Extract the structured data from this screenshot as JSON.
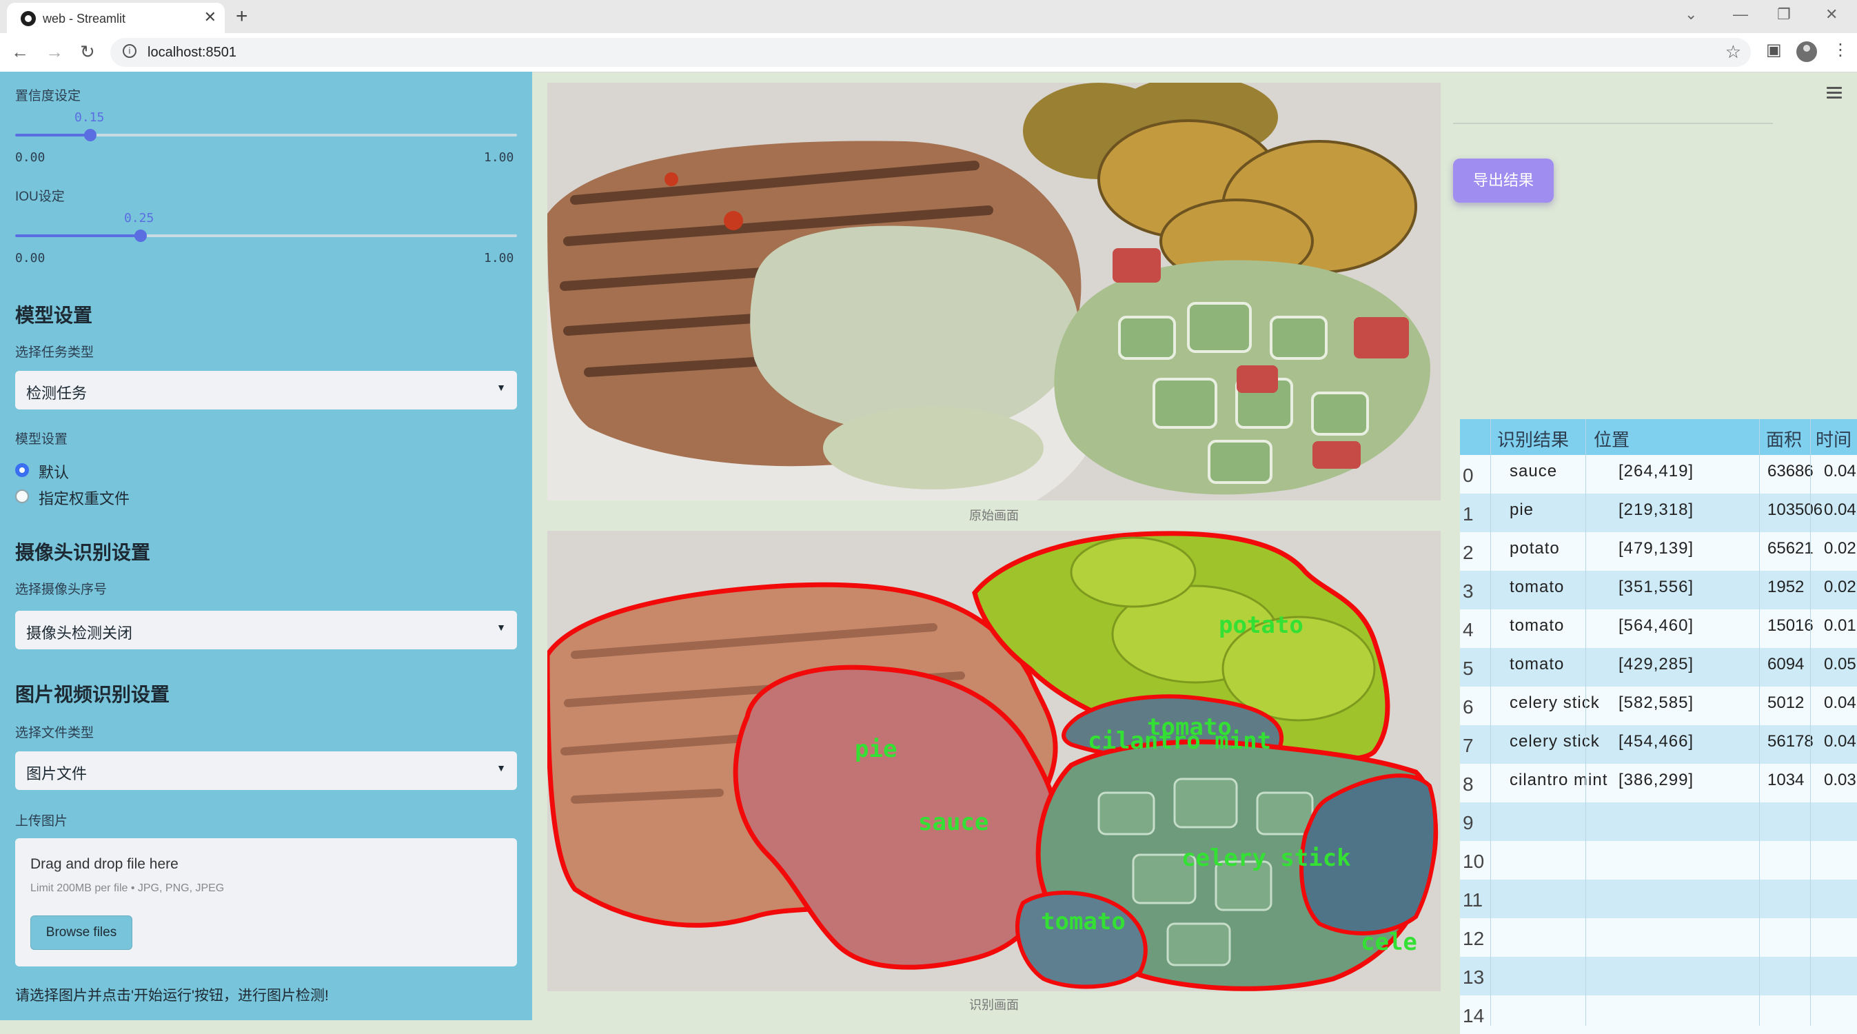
{
  "browser": {
    "tab_title": "web - Streamlit",
    "new_tab": "+",
    "url": "localhost:8501"
  },
  "sidebar": {
    "confidence": {
      "label": "置信度设定",
      "value": "0.15",
      "min": "0.00",
      "max": "1.00",
      "fraction": 0.15
    },
    "iou": {
      "label": "IOU设定",
      "value": "0.25",
      "min": "0.00",
      "max": "1.00",
      "fraction": 0.25
    },
    "model_section": "模型设置",
    "task_label": "选择任务类型",
    "task_value": "检测任务",
    "model_label": "模型设置",
    "radio_default": "默认",
    "radio_custom": "指定权重文件",
    "camera_section": "摄像头识别设置",
    "camera_label": "选择摄像头序号",
    "camera_value": "摄像头检测关闭",
    "media_section": "图片视频识别设置",
    "file_type_label": "选择文件类型",
    "file_type_value": "图片文件",
    "upload_label": "上传图片",
    "upload_title": "Drag and drop file here",
    "upload_hint": "Limit 200MB per file • JPG, PNG, JPEG",
    "browse_label": "Browse files",
    "footer": "请选择图片并点击'开始运行'按钮，进行图片检测!"
  },
  "main": {
    "original_caption": "原始画面",
    "result_caption": "识别画面",
    "detection_labels": {
      "potato": "potato",
      "tomato": "tomato",
      "cilantro": "cilantro mint",
      "pie": "pie",
      "sauce": "sauce",
      "celery": "celery stick",
      "tomato2": "tomato",
      "cele": "cele"
    }
  },
  "right": {
    "export_label": "导出结果",
    "table": {
      "headers": [
        "识别结果",
        "位置",
        "面积",
        "时间"
      ],
      "rows": [
        {
          "idx": "0",
          "name": "sauce",
          "pos": "[264,419]",
          "area": "63686",
          "time": "0.04"
        },
        {
          "idx": "1",
          "name": "pie",
          "pos": "[219,318]",
          "area": "103506",
          "time": "0.04"
        },
        {
          "idx": "2",
          "name": "potato",
          "pos": "[479,139]",
          "area": "65621",
          "time": "0.02"
        },
        {
          "idx": "3",
          "name": "tomato",
          "pos": "[351,556]",
          "area": "1952",
          "time": "0.02"
        },
        {
          "idx": "4",
          "name": "tomato",
          "pos": "[564,460]",
          "area": "15016",
          "time": "0.01"
        },
        {
          "idx": "5",
          "name": "tomato",
          "pos": "[429,285]",
          "area": "6094",
          "time": "0.05"
        },
        {
          "idx": "6",
          "name": "celery stick",
          "pos": "[582,585]",
          "area": "5012",
          "time": "0.04"
        },
        {
          "idx": "7",
          "name": "celery stick",
          "pos": "[454,466]",
          "area": "56178",
          "time": "0.04"
        },
        {
          "idx": "8",
          "name": "cilantro mint",
          "pos": "[386,299]",
          "area": "1034",
          "time": "0.03"
        },
        {
          "idx": "9"
        },
        {
          "idx": "10"
        },
        {
          "idx": "11"
        },
        {
          "idx": "12"
        },
        {
          "idx": "13"
        },
        {
          "idx": "14"
        }
      ]
    }
  }
}
